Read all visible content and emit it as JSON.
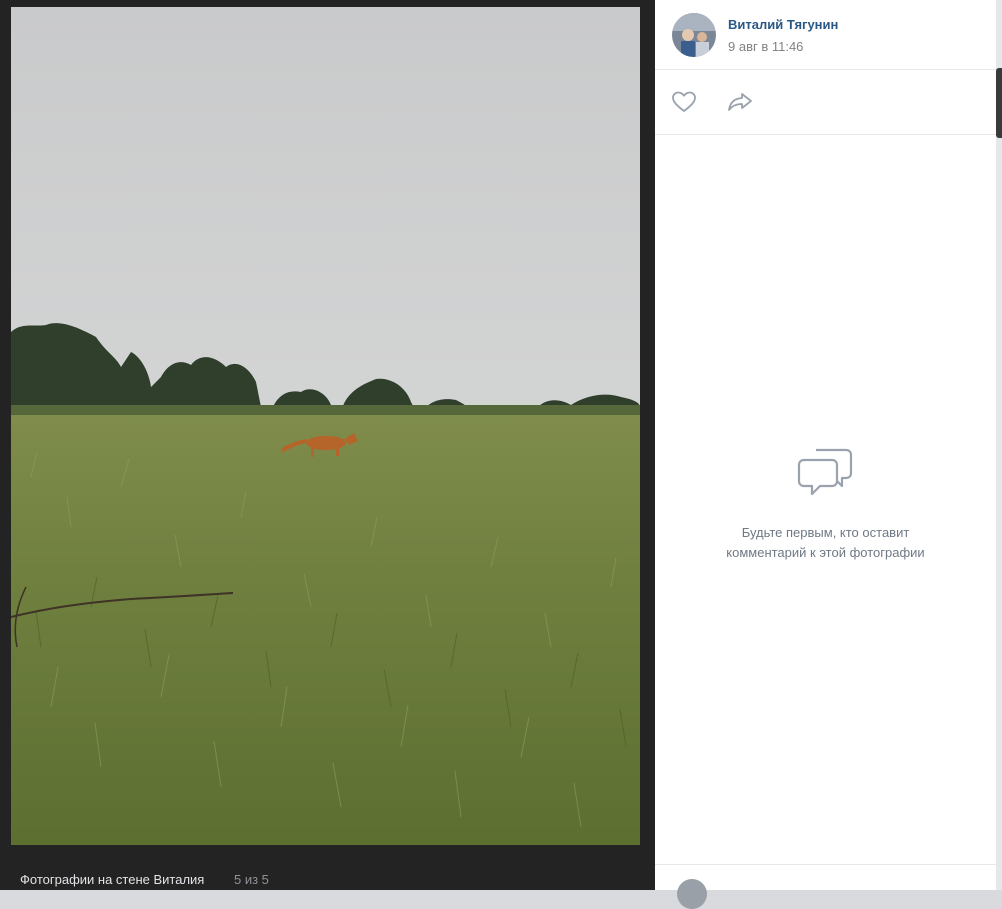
{
  "photo": {
    "caption": "Фотографии на стене Виталия",
    "counter": "5 из 5"
  },
  "post": {
    "author_name": "Виталий Тягунин",
    "date": "9 авг в 11:46"
  },
  "actions": {
    "like_icon": "heart-icon",
    "share_icon": "share-icon"
  },
  "comments": {
    "empty_line1": "Будьте первым, кто оставит",
    "empty_line2": "комментарий к этой фотографии",
    "empty_icon": "chat-bubbles-icon",
    "input_placeholder": ""
  },
  "colors": {
    "link": "#2a5885",
    "muted_text": "#828282",
    "icon_gray": "#99a2ad",
    "viewer_bg": "#1a1a1b"
  }
}
